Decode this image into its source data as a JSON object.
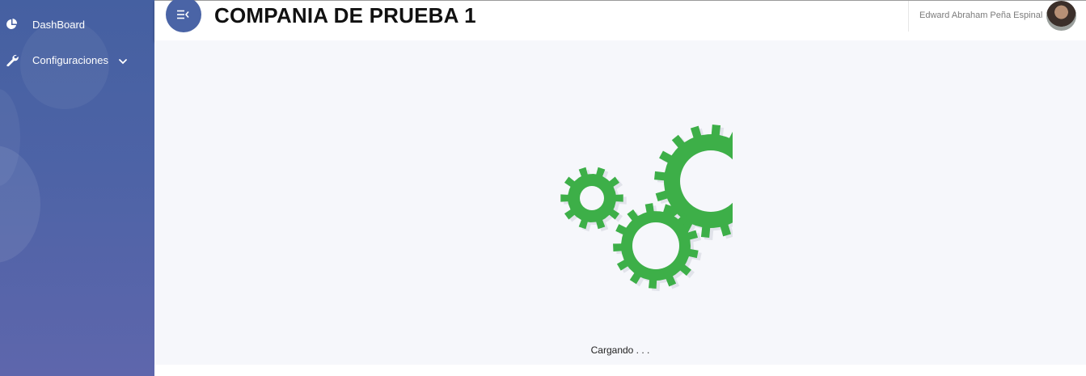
{
  "sidebar": {
    "items": [
      {
        "label": "DashBoard",
        "icon": "pie-chart-icon"
      },
      {
        "label": "Configuraciones",
        "icon": "wrench-icon",
        "has_submenu": true
      }
    ]
  },
  "header": {
    "title": "COMPANIA DE PRUEBA 1",
    "toggle_icon": "menu-collapse-icon",
    "user_name": "Edward Abraham Peña Espinal"
  },
  "main": {
    "loading_text": "Cargando . . ."
  },
  "colors": {
    "sidebar": "#4d63a6",
    "toggle_button": "#4a64a6",
    "gear": "#3daf48",
    "background": "#f6f7fb"
  }
}
